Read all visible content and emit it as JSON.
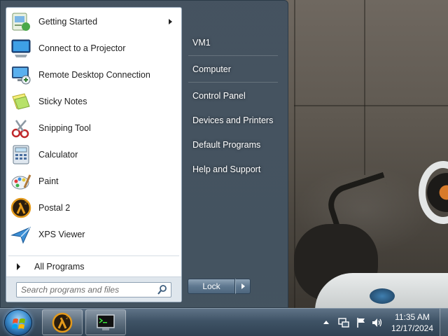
{
  "start_menu": {
    "programs": [
      {
        "label": "Getting Started",
        "icon": "getting-started-icon",
        "has_submenu": true
      },
      {
        "label": "Connect to a Projector",
        "icon": "projector-icon"
      },
      {
        "label": "Remote Desktop Connection",
        "icon": "remote-desktop-icon"
      },
      {
        "label": "Sticky Notes",
        "icon": "sticky-notes-icon"
      },
      {
        "label": "Snipping Tool",
        "icon": "snipping-tool-icon"
      },
      {
        "label": "Calculator",
        "icon": "calculator-icon"
      },
      {
        "label": "Paint",
        "icon": "paint-icon"
      },
      {
        "label": "Postal 2",
        "icon": "postal2-icon"
      },
      {
        "label": "XPS Viewer",
        "icon": "xps-viewer-icon"
      }
    ],
    "all_programs_label": "All Programs",
    "search_placeholder": "Search programs and files",
    "right_items": [
      {
        "label": "VM1"
      },
      {
        "label": "Computer"
      },
      {
        "label": "Control Panel"
      },
      {
        "label": "Devices and Printers"
      },
      {
        "label": "Default Programs"
      },
      {
        "label": "Help and Support"
      }
    ],
    "lock_label": "Lock"
  },
  "taskbar": {
    "pinned": [
      {
        "name": "postal2-taskbar-button",
        "icon": "postal2-icon"
      },
      {
        "name": "terminal-taskbar-button",
        "icon": "terminal-icon"
      }
    ],
    "clock_time": "11:35 AM",
    "clock_date": "12/17/2024"
  },
  "colors": {
    "menu_frame": "#3c4e60",
    "left_pane": "#ffffff",
    "taskbar": "#3f5366",
    "accent": "#3d8fd0"
  }
}
